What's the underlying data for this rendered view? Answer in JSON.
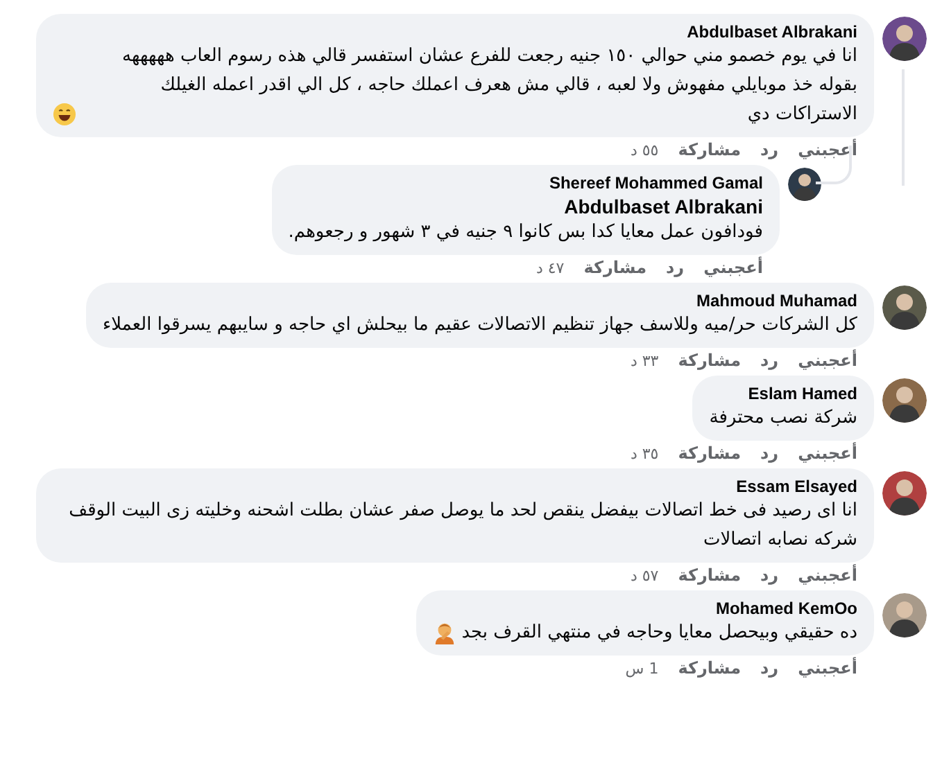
{
  "comments": [
    {
      "author": "Abdulbaset Albrakani",
      "text": "انا في يوم خصمو مني حوالي ١٥٠ جنيه رجعت للفرع عشان استفسر قالي هذه رسوم العاب هههههه بقوله خذ موبايلي مفهوش ولا لعبه ، قالي مش هعرف اعملك حاجه ، كل الي اقدر اعمله الغيلك الاستراكات دي",
      "trailing_emoji": {
        "kind": "smile"
      },
      "actions": {
        "like": "أعجبني",
        "reply": "رد",
        "share": "مشاركة",
        "time": "٥٥ د"
      },
      "replies": [
        {
          "author": "Shereef Mohammed Gamal",
          "mention": "Abdulbaset Albrakani",
          "text": "فودافون عمل معايا كدا بس كانوا ٩ جنيه في ٣ شهور و رجعوهم.",
          "actions": {
            "like": "أعجبني",
            "reply": "رد",
            "share": "مشاركة",
            "time": "٤٧ د"
          }
        }
      ]
    },
    {
      "author": "Mahmoud Muhamad",
      "text": "كل الشركات حر/ميه وللاسف جهاز تنظيم الاتصالات عقيم ما بيحلش اي حاجه و سايبهم يسرقوا العملاء",
      "actions": {
        "like": "أعجبني",
        "reply": "رد",
        "share": "مشاركة",
        "time": "٣٣ د"
      }
    },
    {
      "author": "Eslam Hamed",
      "text": "شركة نصب محترفة",
      "actions": {
        "like": "أعجبني",
        "reply": "رد",
        "share": "مشاركة",
        "time": "٣٥ د"
      }
    },
    {
      "author": "Essam Elsayed",
      "text": "انا اى رصيد فى خط اتصالات بيفضل ينقص لحد ما يوصل صفر عشان بطلت اشحنه وخليته زى البيت الوقف شركه نصابه اتصالات",
      "actions": {
        "like": "أعجبني",
        "reply": "رد",
        "share": "مشاركة",
        "time": "٥٧ د"
      }
    },
    {
      "author": "Mohamed KemOo",
      "text": "ده حقيقي وبيحصل معايا وحاجه في منتهي القرف بجد",
      "trailing_emoji": {
        "kind": "facepalm"
      },
      "actions": {
        "like": "أعجبني",
        "reply": "رد",
        "share": "مشاركة",
        "time": "1 س"
      }
    }
  ]
}
